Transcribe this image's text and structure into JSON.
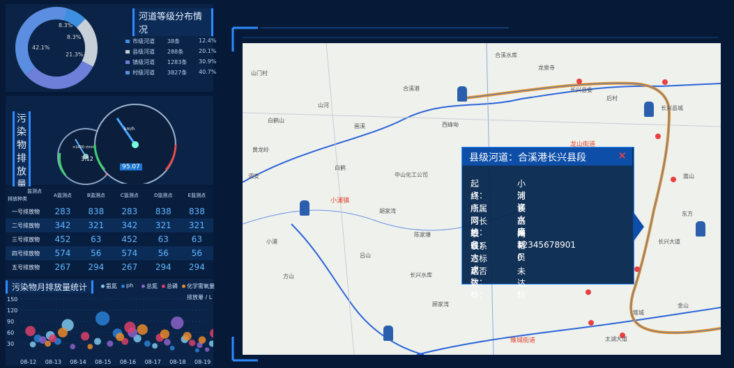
{
  "grade_panel": {
    "title": "河道等级分布情况",
    "donut_labels": [
      "8.3%",
      "8.3%",
      "42.1%",
      "21.3%"
    ],
    "items": [
      {
        "name": "市级河道",
        "count": "38条",
        "pct": "12.4%",
        "color": "#3f8fe0"
      },
      {
        "name": "县级河道",
        "count": "288条",
        "pct": "20.1%",
        "color": "#c7cfd8"
      },
      {
        "name": "镇级河道",
        "count": "1283条",
        "pct": "30.9%",
        "color": "#6d7fd8"
      },
      {
        "name": "村级河道",
        "count": "3827条",
        "pct": "40.7%",
        "color": "#5b8ee0"
      }
    ]
  },
  "gauge_panel": {
    "title": "污染物排放量",
    "small_gauge": {
      "label": "×1000 r/min",
      "value": "3.12"
    },
    "big_gauge": {
      "unit": "km/h",
      "value": "95.07"
    }
  },
  "table": {
    "corner_top": "监测点",
    "corner_bottom": "排放种类",
    "columns": [
      "A监测点",
      "B监测点",
      "C监测点",
      "D监测点",
      "E监测点"
    ],
    "rows": [
      {
        "label": "一号排放物",
        "values": [
          "283",
          "838",
          "283",
          "838",
          "838"
        ]
      },
      {
        "label": "二号排放物",
        "values": [
          "342",
          "321",
          "342",
          "321",
          "321"
        ]
      },
      {
        "label": "三号排放物",
        "values": [
          "452",
          "63",
          "452",
          "63",
          "63"
        ]
      },
      {
        "label": "四号排放物",
        "values": [
          "574",
          "56",
          "574",
          "56",
          "56"
        ]
      },
      {
        "label": "五号排放物",
        "values": [
          "267",
          "294",
          "267",
          "294",
          "294"
        ]
      }
    ]
  },
  "bubble_panel": {
    "title": "污染物月排放量统计",
    "legend": [
      {
        "name": "氨氮",
        "color": "#7ec8ec"
      },
      {
        "name": "ph",
        "color": "#2a7fd6"
      },
      {
        "name": "总氮",
        "color": "#8b63c9"
      },
      {
        "name": "总磷",
        "color": "#d9416a"
      },
      {
        "name": "化学需氧量",
        "color": "#e98a2a"
      }
    ],
    "unit": "排放量 / L"
  },
  "chart_data": {
    "type": "scatter",
    "title": "污染物月排放量统计",
    "ylabel": "排放量 / L",
    "ylim": [
      0,
      150
    ],
    "yticks": [
      30,
      60,
      90,
      120,
      150
    ],
    "categories": [
      "08-12",
      "08-13",
      "08-14",
      "08-15",
      "08-16",
      "08-17",
      "08-18",
      "08-19"
    ],
    "series": [
      {
        "name": "氨氮",
        "points": [
          [
            0.2,
            28
          ],
          [
            0.9,
            52
          ],
          [
            1.6,
            80
          ],
          [
            2.8,
            36
          ],
          [
            4.4,
            44
          ],
          [
            5.1,
            24
          ],
          [
            6.3,
            42
          ],
          [
            7.4,
            30
          ]
        ]
      },
      {
        "name": "ph",
        "points": [
          [
            0.4,
            44
          ],
          [
            1.2,
            36
          ],
          [
            3.0,
            98
          ],
          [
            3.6,
            58
          ],
          [
            4.8,
            30
          ],
          [
            5.8,
            18
          ],
          [
            6.8,
            12
          ],
          [
            7.7,
            20
          ]
        ]
      },
      {
        "name": "总氮",
        "points": [
          [
            0.6,
            40
          ],
          [
            1.8,
            22
          ],
          [
            3.3,
            30
          ],
          [
            4.2,
            60
          ],
          [
            5.6,
            34
          ],
          [
            6.0,
            86
          ],
          [
            6.9,
            26
          ],
          [
            7.2,
            14
          ]
        ]
      },
      {
        "name": "总磷",
        "points": [
          [
            0.1,
            64
          ],
          [
            1.0,
            44
          ],
          [
            2.3,
            50
          ],
          [
            3.9,
            36
          ],
          [
            4.1,
            74
          ],
          [
            5.3,
            46
          ],
          [
            6.6,
            32
          ],
          [
            7.5,
            58
          ]
        ]
      },
      {
        "name": "化学需氧量",
        "points": [
          [
            0.8,
            30
          ],
          [
            1.4,
            60
          ],
          [
            2.5,
            22
          ],
          [
            3.7,
            48
          ],
          [
            4.6,
            68
          ],
          [
            5.5,
            56
          ],
          [
            6.4,
            50
          ],
          [
            7.0,
            40
          ]
        ]
      }
    ]
  },
  "map": {
    "place_labels": [
      "小浦镇",
      "雉城街道",
      "龙山街道",
      "山门村",
      "长兴县委",
      "小浦",
      "长兴县城",
      "合溪港",
      "山河",
      "黄龙岭",
      "画溪",
      "中山化工公司",
      "白鹤",
      "胡家湾",
      "白鹤山",
      "西峰坳",
      "陈家塘",
      "吕山",
      "方山",
      "泗安",
      "顾家湾",
      "长兴水库",
      "太湖大道",
      "雉城",
      "金山",
      "后村",
      "长兴大道",
      "嵩山",
      "东方",
      "合溪水库",
      "龙泉寺"
    ],
    "popup": {
      "title": "县级河道：合溪港长兴县段",
      "close_icon": "close-icon",
      "fields": [
        {
          "k": "起点：",
          "v": "小浦诈"
        },
        {
          "k": "终点：",
          "v": "河溪水库"
        },
        {
          "k": "所属网格：",
          "v": "长兴县"
        },
        {
          "k": "河长姓名：",
          "v": "王维新"
        },
        {
          "k": "职位：",
          "v": "网格员"
        },
        {
          "k": "联系方式：",
          "v": "12345678901"
        },
        {
          "k": "达标次数：",
          "v": "0"
        },
        {
          "k": "是否达标：",
          "v": "未达标"
        }
      ]
    }
  }
}
